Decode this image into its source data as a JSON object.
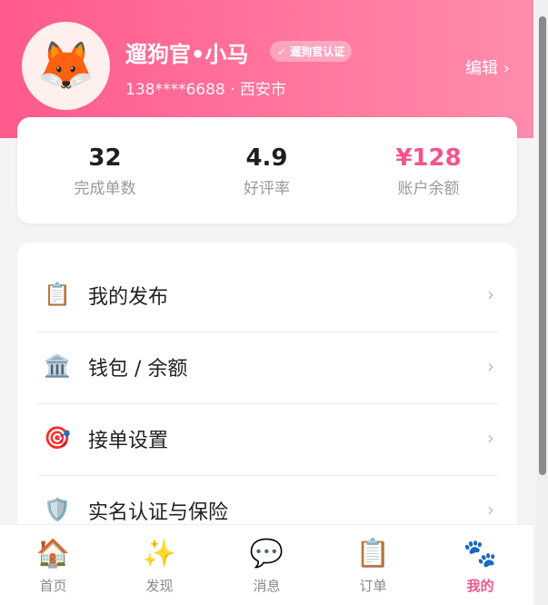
{
  "profile": {
    "avatar_icon": "fox-face-icon",
    "name": "遛狗官•小马",
    "badge": "✓ 遛狗官认证",
    "sub": "138****6688 · 西安市",
    "edit": "编辑 ›"
  },
  "stats": [
    {
      "value": "32",
      "label": "完成单数"
    },
    {
      "value": "4.9",
      "label": "好评率"
    },
    {
      "value": "¥128",
      "label": "账户余额"
    }
  ],
  "menu": [
    {
      "icon": "clipboard-icon",
      "label": "我的发布"
    },
    {
      "icon": "bank-icon",
      "label": "钱包 / 余额"
    },
    {
      "icon": "target-icon",
      "label": "接单设置"
    },
    {
      "icon": "shield-icon",
      "label": "实名认证与保险"
    }
  ],
  "tabs": [
    {
      "icon": "house-icon",
      "label": "首页"
    },
    {
      "icon": "sparkles-icon",
      "label": "发现"
    },
    {
      "icon": "speech-bubble-icon",
      "label": "消息"
    },
    {
      "icon": "clipboard-icon",
      "label": "订单"
    },
    {
      "icon": "paw-icon",
      "label": "我的"
    }
  ],
  "colors": {
    "accent": "#f2558a",
    "header_start": "#ff5a8c",
    "header_end": "#ff8cab"
  }
}
